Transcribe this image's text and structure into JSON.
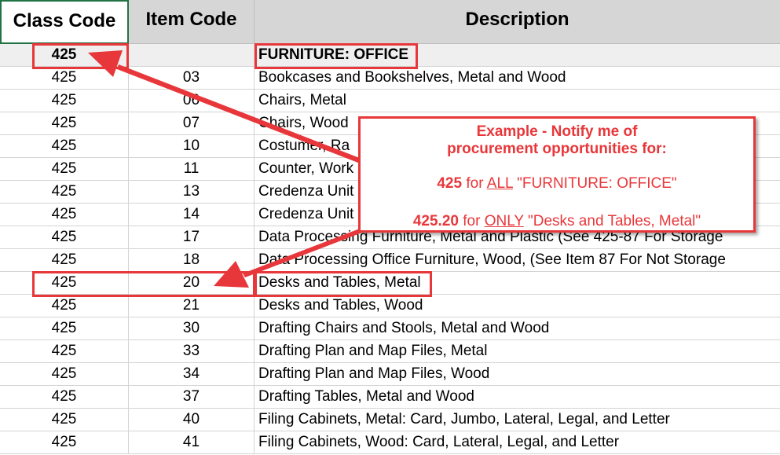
{
  "headers": {
    "class_code": "Class Code",
    "item_code": "Item Code",
    "description": "Description"
  },
  "rows": [
    {
      "class": "425",
      "item": "",
      "desc": "FURNITURE: OFFICE"
    },
    {
      "class": "425",
      "item": "03",
      "desc": "Bookcases and Bookshelves, Metal and Wood"
    },
    {
      "class": "425",
      "item": "06",
      "desc": "Chairs, Metal"
    },
    {
      "class": "425",
      "item": "07",
      "desc": "Chairs, Wood"
    },
    {
      "class": "425",
      "item": "10",
      "desc": "Costumer, Ra"
    },
    {
      "class": "425",
      "item": "11",
      "desc": "Counter, Work"
    },
    {
      "class": "425",
      "item": "13",
      "desc": "Credenza Unit"
    },
    {
      "class": "425",
      "item": "14",
      "desc": "Credenza Unit"
    },
    {
      "class": "425",
      "item": "17",
      "desc": "Data Processing Furniture, Metal and Plastic (See 425-87 For Storage"
    },
    {
      "class": "425",
      "item": "18",
      "desc": "Data Processing Office Furniture, Wood, (See Item 87 For Not Storage"
    },
    {
      "class": "425",
      "item": "20",
      "desc": "Desks and Tables, Metal"
    },
    {
      "class": "425",
      "item": "21",
      "desc": "Desks and Tables, Wood"
    },
    {
      "class": "425",
      "item": "30",
      "desc": "Drafting Chairs and Stools, Metal and Wood"
    },
    {
      "class": "425",
      "item": "33",
      "desc": "Drafting Plan and Map Files, Metal"
    },
    {
      "class": "425",
      "item": "34",
      "desc": "Drafting Plan and Map Files, Wood"
    },
    {
      "class": "425",
      "item": "37",
      "desc": "Drafting Tables, Metal and Wood"
    },
    {
      "class": "425",
      "item": "40",
      "desc": "Filing Cabinets, Metal: Card, Jumbo, Lateral, Legal, and Letter"
    },
    {
      "class": "425",
      "item": "41",
      "desc": "Filing Cabinets, Wood: Card, Lateral, Legal, and Letter"
    }
  ],
  "callout": {
    "line1": "Example - Notify me of",
    "line2": "procurement opportunities for:",
    "line3_code": "425",
    "line3_for": "for",
    "line3_scope": "ALL",
    "line3_name": "\"FURNITURE: OFFICE\"",
    "line4_code": "425.20",
    "line4_for": "for",
    "line4_scope": "ONLY",
    "line4_name": "\"Desks and Tables, Metal\""
  },
  "colors": {
    "accent_red": "#e8373a",
    "header_gray": "#d6d6d6",
    "selection_green": "#217346"
  }
}
